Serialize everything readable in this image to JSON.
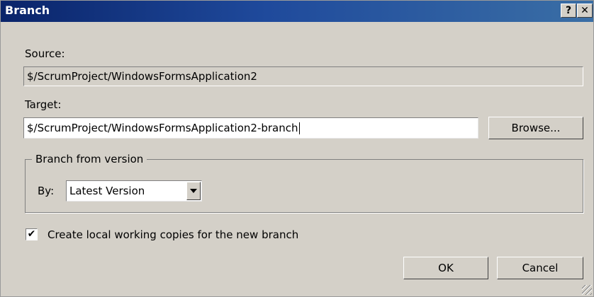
{
  "window": {
    "title": "Branch",
    "help_glyph": "?",
    "close_glyph": "✕"
  },
  "source": {
    "label": "Source:",
    "value": "$/ScrumProject/WindowsFormsApplication2"
  },
  "target": {
    "label": "Target:",
    "value": "$/ScrumProject/WindowsFormsApplication2-branch"
  },
  "browse_button": "Browse...",
  "branch_from": {
    "group_label": "Branch from version",
    "by_label": "By:",
    "selected": "Latest Version"
  },
  "local_copies": {
    "label": "Create local working copies for the new branch",
    "checked": true,
    "check_glyph": "✔"
  },
  "ok_button": "OK",
  "cancel_button": "Cancel",
  "colors": {
    "titlebar": "#0a246a",
    "dialog_bg": "#d4d0c8"
  }
}
